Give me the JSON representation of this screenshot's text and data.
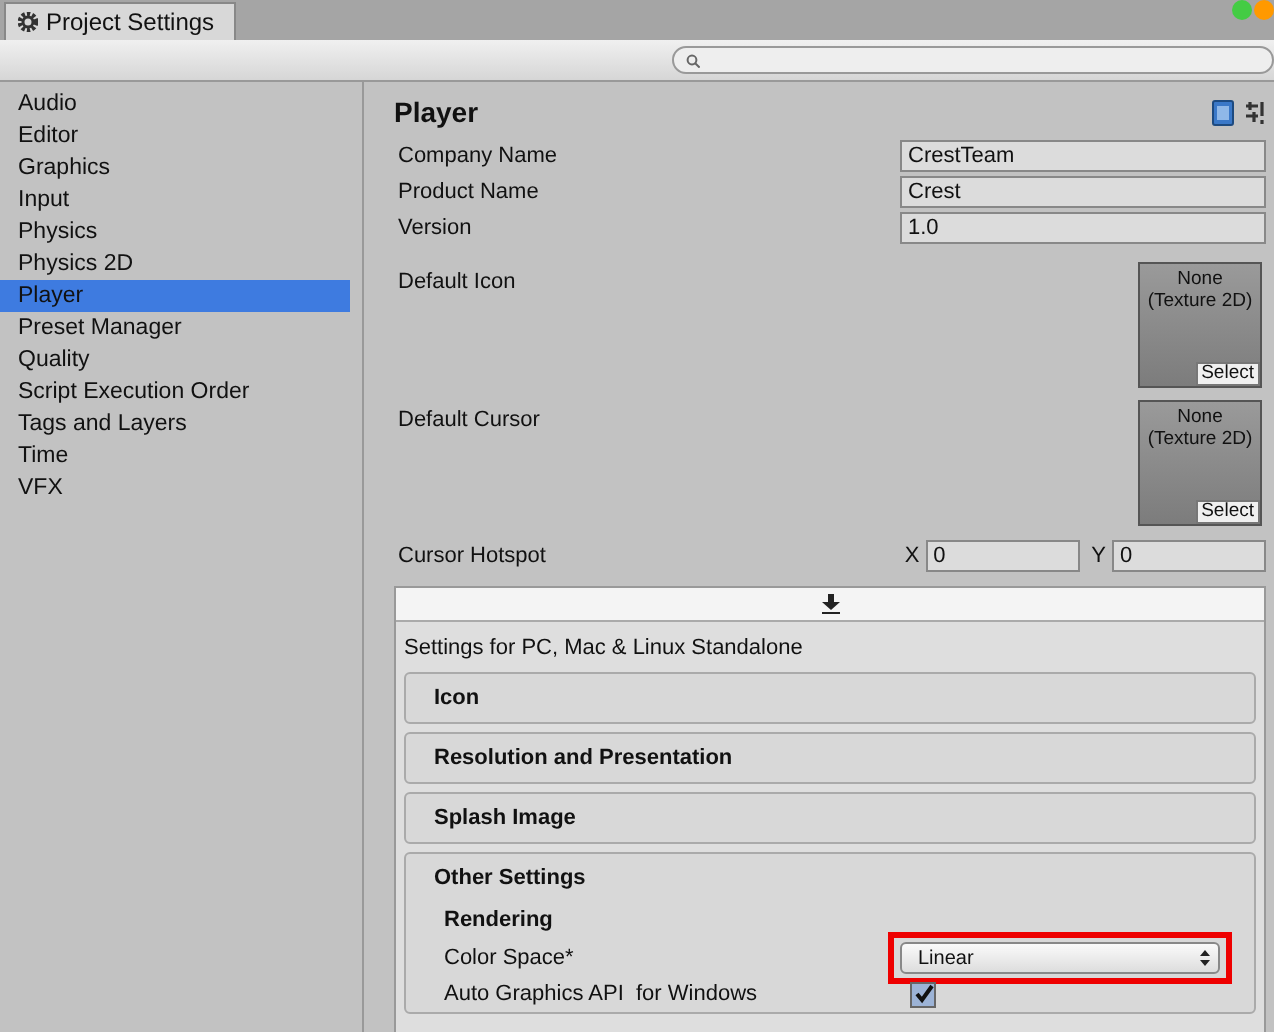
{
  "window": {
    "tab_title": "Project Settings"
  },
  "sidebar": {
    "items": [
      {
        "label": "Audio",
        "selected": false
      },
      {
        "label": "Editor",
        "selected": false
      },
      {
        "label": "Graphics",
        "selected": false
      },
      {
        "label": "Input",
        "selected": false
      },
      {
        "label": "Physics",
        "selected": false
      },
      {
        "label": "Physics 2D",
        "selected": false
      },
      {
        "label": "Player",
        "selected": true
      },
      {
        "label": "Preset Manager",
        "selected": false
      },
      {
        "label": "Quality",
        "selected": false
      },
      {
        "label": "Script Execution Order",
        "selected": false
      },
      {
        "label": "Tags and Layers",
        "selected": false
      },
      {
        "label": "Time",
        "selected": false
      },
      {
        "label": "VFX",
        "selected": false
      }
    ]
  },
  "panel": {
    "title": "Player",
    "fields": [
      {
        "label": "Company Name",
        "value": "CrestTeam"
      },
      {
        "label": "Product Name",
        "value": "Crest"
      },
      {
        "label": "Version",
        "value": "1.0"
      }
    ],
    "textures": [
      {
        "label": "Default Icon",
        "line1": "None",
        "line2": "(Texture 2D)",
        "button": "Select"
      },
      {
        "label": "Default Cursor",
        "line1": "None",
        "line2": "(Texture 2D)",
        "button": "Select"
      }
    ],
    "hotspot": {
      "label": "Cursor Hotspot",
      "x_label": "X",
      "x_value": "0",
      "y_label": "Y",
      "y_value": "0"
    },
    "platform": {
      "title": "Settings for PC, Mac & Linux Standalone",
      "sections": [
        {
          "title": "Icon",
          "expanded": false
        },
        {
          "title": "Resolution and Presentation",
          "expanded": false
        },
        {
          "title": "Splash Image",
          "expanded": false
        },
        {
          "title": "Other Settings",
          "expanded": true
        }
      ],
      "subheading": "Rendering",
      "settings": [
        {
          "kind": "dropdown",
          "label": "Color Space*",
          "value": "Linear",
          "highlighted": true
        },
        {
          "kind": "checkbox",
          "label": "Auto Graphics API  for Windows",
          "checked": true
        }
      ]
    }
  }
}
